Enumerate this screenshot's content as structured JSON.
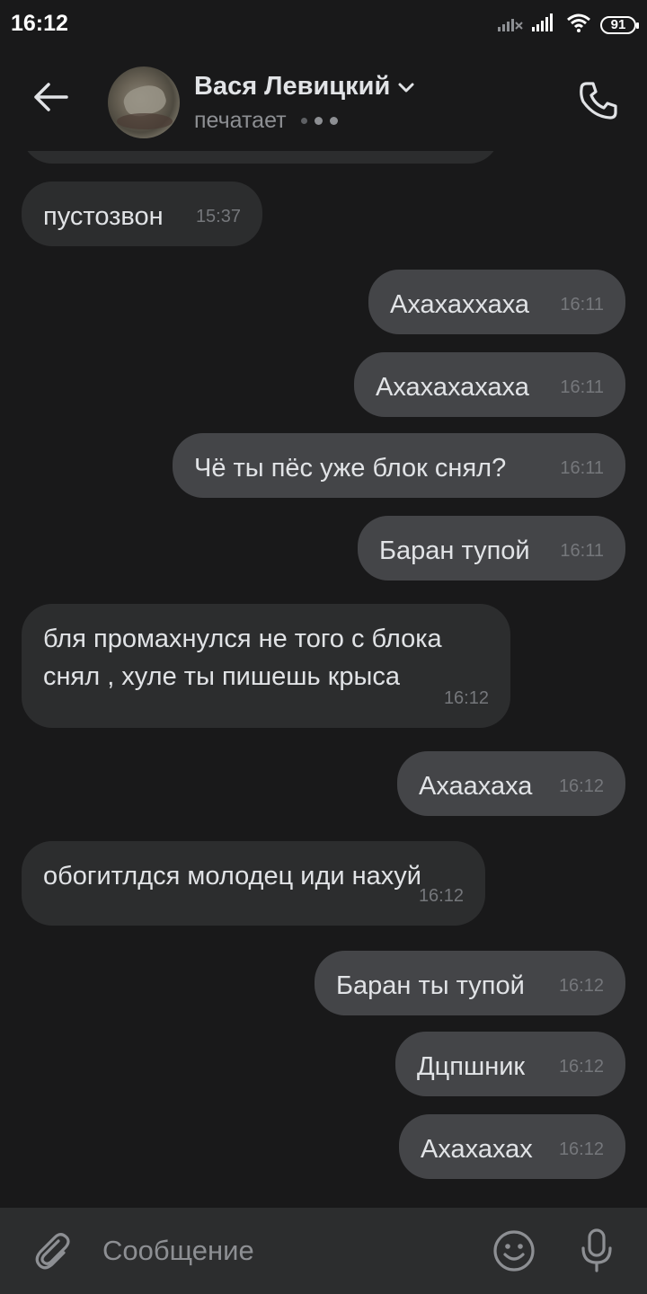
{
  "status_bar": {
    "time": "16:12",
    "battery": "91"
  },
  "header": {
    "contact_name": "Вася Левицкий",
    "status": "печатает"
  },
  "messages": [
    {
      "dir": "in",
      "text": "пустозвон",
      "time": "15:37"
    },
    {
      "dir": "out",
      "text": "Ахахаххаха",
      "time": "16:11"
    },
    {
      "dir": "out",
      "text": "Ахахахахаха",
      "time": "16:11"
    },
    {
      "dir": "out",
      "text": "Чё ты пёс уже блок снял?",
      "time": "16:11"
    },
    {
      "dir": "out",
      "text": "Баран тупой",
      "time": "16:11"
    },
    {
      "dir": "in",
      "text": "бля промахнулся не того с блока снял , хуле ты пишешь крыса",
      "time": "16:12"
    },
    {
      "dir": "out",
      "text": "Ахаахаха",
      "time": "16:12"
    },
    {
      "dir": "in",
      "text": "обогитлдся молодец иди нахуй",
      "time": "16:12"
    },
    {
      "dir": "out",
      "text": "Баран ты тупой",
      "time": "16:12"
    },
    {
      "dir": "out",
      "text": "Дцпшник",
      "time": "16:12"
    },
    {
      "dir": "out",
      "text": "Ахахахах",
      "time": "16:12"
    }
  ],
  "composer": {
    "placeholder": "Сообщение"
  }
}
